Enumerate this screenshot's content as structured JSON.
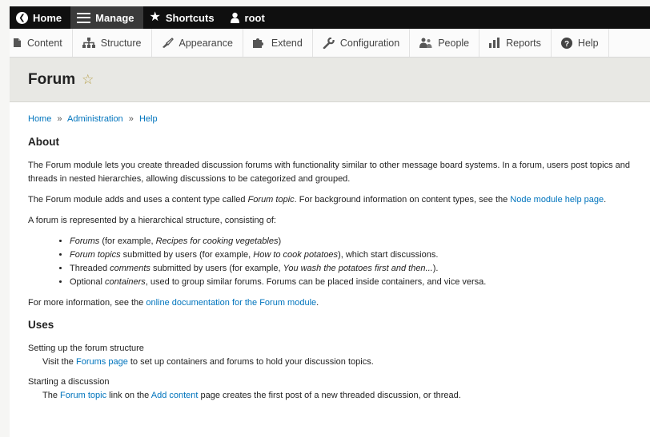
{
  "toolbar": {
    "home": "Home",
    "manage": "Manage",
    "shortcuts": "Shortcuts",
    "user": "root"
  },
  "tray": {
    "content": "Content",
    "structure": "Structure",
    "appearance": "Appearance",
    "extend": "Extend",
    "configuration": "Configuration",
    "people": "People",
    "reports": "Reports",
    "help": "Help"
  },
  "page": {
    "title": "Forum"
  },
  "breadcrumb": {
    "home": "Home",
    "sep1": "»",
    "administration": "Administration",
    "sep2": "»",
    "help": "Help"
  },
  "about": {
    "heading": "About",
    "p1": "The Forum module lets you create threaded discussion forums with functionality similar to other message board systems. In a forum, users post topics and threads in nested hierarchies, allowing discussions to be categorized and grouped.",
    "p2_before": "The Forum module adds and uses a content type called ",
    "p2_em": "Forum topic",
    "p2_mid": ". For background information on content types, see the ",
    "p2_link": "Node module help page",
    "p2_after": ".",
    "p3": "A forum is represented by a hierarchical structure, consisting of:",
    "list": {
      "i1_em": "Forums",
      "i1_a": " (for example, ",
      "i1_em2": "Recipes for cooking vegetables",
      "i1_b": ")",
      "i2_em": "Forum topics",
      "i2_a": " submitted by users (for example, ",
      "i2_em2": "How to cook potatoes",
      "i2_b": "), which start discussions.",
      "i3_a": "Threaded ",
      "i3_em": "comments",
      "i3_b": " submitted by users (for example, ",
      "i3_em2": "You wash the potatoes first and then...",
      "i3_c": ").",
      "i4_a": "Optional ",
      "i4_em": "containers",
      "i4_b": ", used to group similar forums. Forums can be placed inside containers, and vice versa."
    },
    "p4_before": "For more information, see the ",
    "p4_link": "online documentation for the Forum module",
    "p4_after": "."
  },
  "uses": {
    "heading": "Uses",
    "item1_title": "Setting up the forum structure",
    "item1_before": "Visit the ",
    "item1_link": "Forums page",
    "item1_after": " to set up containers and forums to hold your discussion topics.",
    "item2_title": "Starting a discussion",
    "item2_before": "The ",
    "item2_link1": "Forum topic",
    "item2_mid": " link on the ",
    "item2_link2": "Add content",
    "item2_after": " page creates the first post of a new threaded discussion, or thread."
  }
}
